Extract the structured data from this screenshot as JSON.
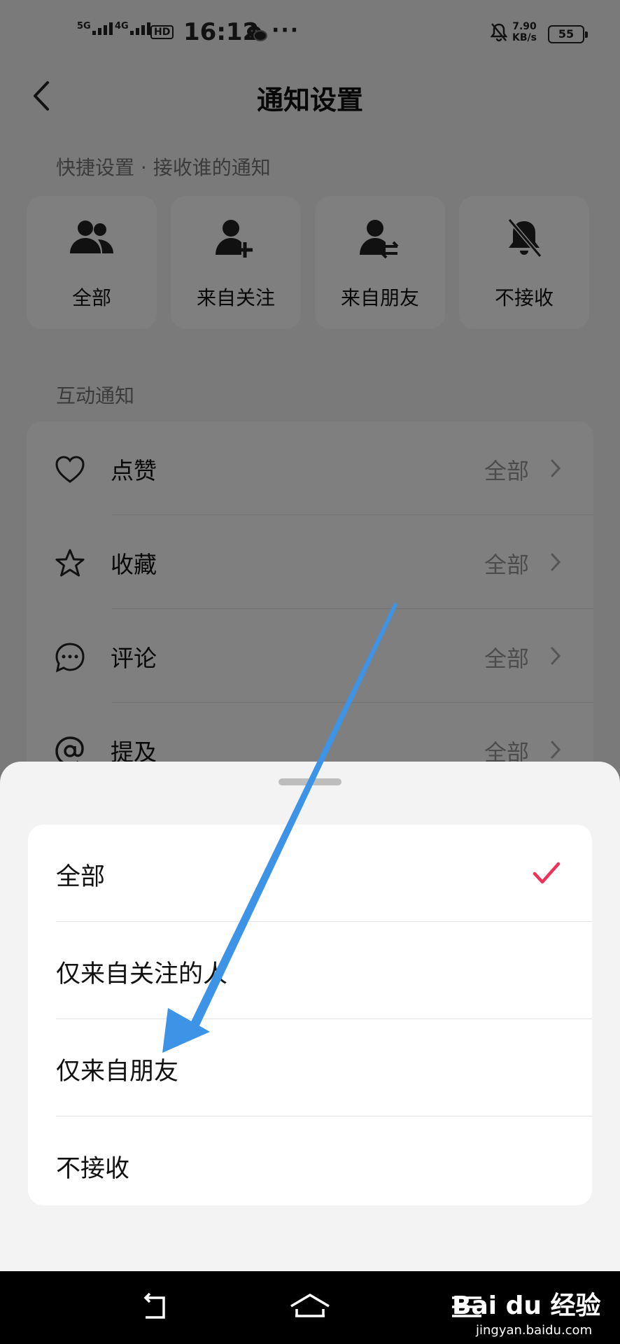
{
  "status_bar": {
    "sig1": "5G",
    "sig2": "4G",
    "hd": "HD",
    "time": "16:12",
    "dots": "···",
    "speed_value": "7.90",
    "speed_unit": "KB/s",
    "battery": "55"
  },
  "nav": {
    "title": "通知设置"
  },
  "quick": {
    "label": "快捷设置 · 接收谁的通知",
    "items": [
      {
        "label": "全部",
        "icon": "people-icon"
      },
      {
        "label": "来自关注",
        "icon": "person-add-icon"
      },
      {
        "label": "来自朋友",
        "icon": "person-swap-icon"
      },
      {
        "label": "不接收",
        "icon": "bell-off-icon"
      }
    ]
  },
  "interaction": {
    "label": "互动通知",
    "rows": [
      {
        "name": "点赞",
        "value": "全部",
        "icon": "heart-icon"
      },
      {
        "name": "收藏",
        "value": "全部",
        "icon": "star-icon"
      },
      {
        "name": "评论",
        "value": "全部",
        "icon": "comment-icon"
      },
      {
        "name": "提及",
        "value": "全部",
        "icon": "at-icon"
      }
    ]
  },
  "sheet": {
    "options": [
      {
        "label": "全部",
        "selected": true
      },
      {
        "label": "仅来自关注的人",
        "selected": false
      },
      {
        "label": "仅来自朋友",
        "selected": false
      },
      {
        "label": "不接收",
        "selected": false
      }
    ]
  },
  "watermark": {
    "logo": "Bai du 经验",
    "url": "jingyan.baidu.com"
  },
  "colors": {
    "check": "#f0325a",
    "arrow": "#3d93e6"
  }
}
